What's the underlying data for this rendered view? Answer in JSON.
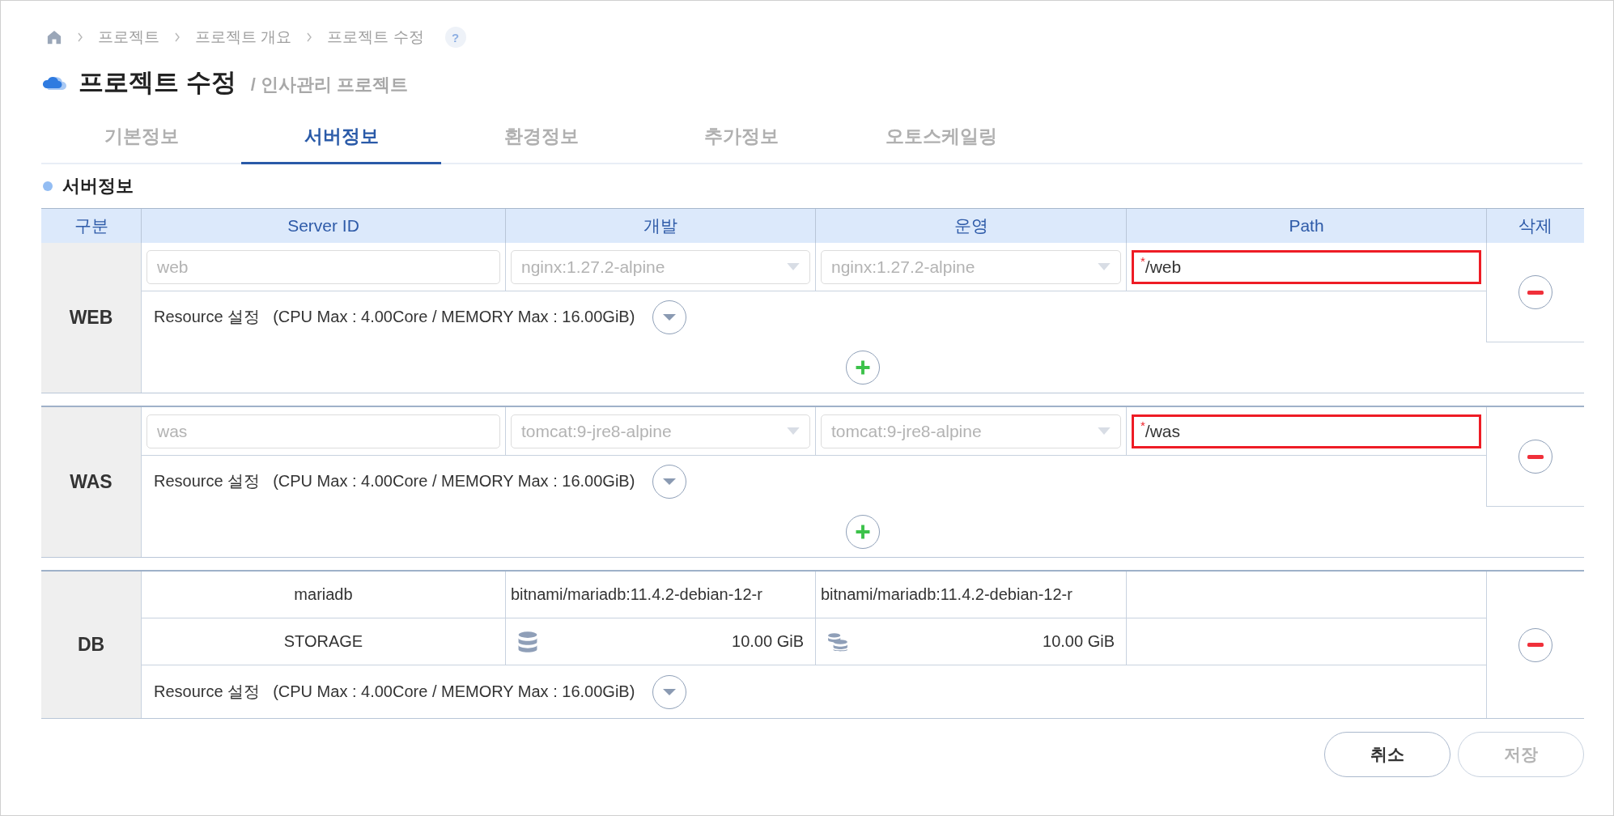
{
  "breadcrumb": {
    "items": [
      "프로젝트",
      "프로젝트 개요",
      "프로젝트 수정"
    ],
    "help": "?"
  },
  "title": "프로젝트 수정",
  "subtitle": "/ 인사관리 프로젝트",
  "tabs": [
    {
      "label": "기본정보",
      "selected": false
    },
    {
      "label": "서버정보",
      "selected": true
    },
    {
      "label": "환경정보",
      "selected": false
    },
    {
      "label": "추가정보",
      "selected": false
    },
    {
      "label": "오토스케일링",
      "selected": false
    }
  ],
  "section_title": "서버정보",
  "table": {
    "columns": [
      "구분",
      "Server ID",
      "개발",
      "운영",
      "Path",
      "삭제"
    ],
    "groups": [
      {
        "kind": "app",
        "label": "WEB",
        "server_id": {
          "value": "web",
          "disabled": true
        },
        "dev_image": {
          "value": "nginx:1.27.2-alpine",
          "disabled": true
        },
        "ops_image": {
          "value": "nginx:1.27.2-alpine",
          "disabled": true
        },
        "path": {
          "value": "/web",
          "required_mark": "*",
          "invalid": true
        },
        "resource": "Resource 설정",
        "resource_limits": "(CPU Max : 4.00Core / MEMORY Max : 16.00GiB)"
      },
      {
        "kind": "app",
        "label": "WAS",
        "server_id": {
          "value": "was",
          "disabled": true
        },
        "dev_image": {
          "value": "tomcat:9-jre8-alpine",
          "disabled": true
        },
        "ops_image": {
          "value": "tomcat:9-jre8-alpine",
          "disabled": true
        },
        "path": {
          "value": "/was",
          "required_mark": "*",
          "invalid": true
        },
        "resource": "Resource 설정",
        "resource_limits": "(CPU Max : 4.00Core / MEMORY Max : 16.00GiB)"
      },
      {
        "kind": "db",
        "label": "DB",
        "name": "mariadb",
        "dev_image": "bitnami/mariadb:11.4.2-debian-12-r",
        "ops_image": "bitnami/mariadb:11.4.2-debian-12-r",
        "storage_label": "STORAGE",
        "dev_storage": "10.00 GiB",
        "ops_storage": "10.00 GiB",
        "resource": "Resource 설정",
        "resource_limits": "(CPU Max : 4.00Core / MEMORY Max : 16.00GiB)"
      }
    ]
  },
  "buttons": [
    {
      "label": "취소",
      "disabled": false
    },
    {
      "label": "저장",
      "disabled": true
    }
  ]
}
